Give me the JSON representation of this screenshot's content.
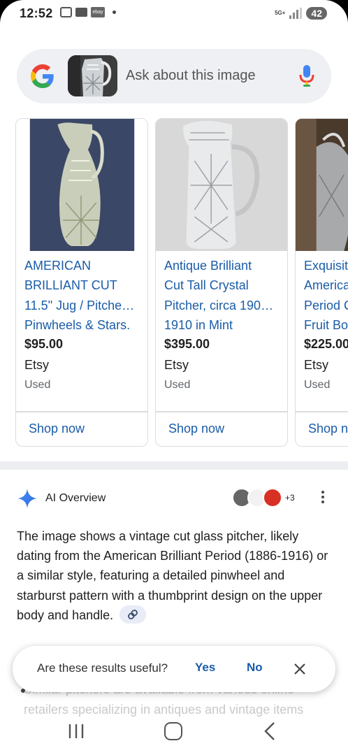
{
  "status_bar": {
    "time": "12:52",
    "network": "5G+",
    "battery": "42"
  },
  "search": {
    "placeholder": "Ask about this image"
  },
  "products": [
    {
      "title": "AMERICAN\nBRILLIANT CUT\n11.5\" Jug / Pitche…\nPinwheels & Stars.",
      "price": "$95.00",
      "seller": "Etsy",
      "condition": "Used",
      "cta": "Shop now"
    },
    {
      "title": "Antique Brilliant\nCut Tall Crystal\nPitcher, circa 190…\n1910 in Mint",
      "price": "$395.00",
      "seller": "Etsy",
      "condition": "Used",
      "cta": "Shop now"
    },
    {
      "title": "Exquisit\nAmerica\nPeriod C\nFruit Bo",
      "price": "$225.00",
      "seller": "Etsy",
      "condition": "Used",
      "cta": "Shop n"
    }
  ],
  "ai_overview": {
    "title": "AI Overview",
    "source_count": "+3",
    "body": "The image shows a vintage cut glass pitcher, likely dating from the American Brilliant Period (1886-1916) or a similar style, featuring a detailed pinwheel and starburst pattern with a thumbprint design on the upper body and handle.",
    "bullet": "Similar pitchers are available from various online retailers specializing in antiques and vintage items"
  },
  "feedback": {
    "question": "Are these results useful?",
    "yes": "Yes",
    "no": "No"
  },
  "colors": {
    "link_blue": "#1a5ca8",
    "google_blue": "#4285f4",
    "google_red": "#ea4335",
    "google_yellow": "#fbbc05",
    "google_green": "#34a853"
  }
}
